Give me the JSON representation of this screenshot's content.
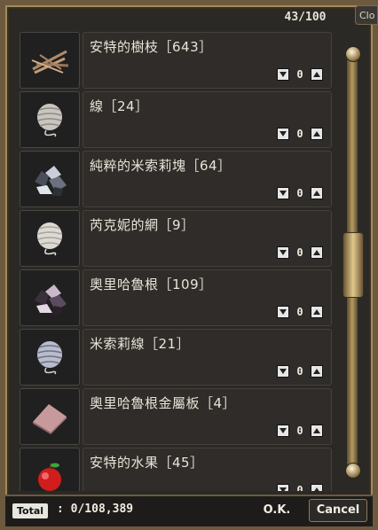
{
  "header": {
    "counter": "43/100",
    "close_tab": "Clo"
  },
  "items": [
    {
      "name": "安特的樹枝［643］",
      "qty": "0",
      "icon": "twig-bundle-icon"
    },
    {
      "name": "線［24］",
      "qty": "0",
      "icon": "thread-spool-icon"
    },
    {
      "name": "純粹的米索莉塊［64］",
      "qty": "0",
      "icon": "mithril-ore-icon"
    },
    {
      "name": "芮克妮的網［9］",
      "qty": "0",
      "icon": "web-spool-icon"
    },
    {
      "name": "奧里哈魯根［109］",
      "qty": "0",
      "icon": "oriharukon-ore-icon"
    },
    {
      "name": "米索莉線［21］",
      "qty": "0",
      "icon": "mithril-thread-icon"
    },
    {
      "name": "奧里哈魯根金屬板［4］",
      "qty": "0",
      "icon": "metal-plate-icon"
    },
    {
      "name": "安特的水果［45］",
      "qty": "0",
      "icon": "apple-fruit-icon"
    }
  ],
  "footer": {
    "total_label": "Total",
    "total_value": ": 0/108,389",
    "ok_label": "O.K.",
    "cancel_label": "Cancel"
  }
}
